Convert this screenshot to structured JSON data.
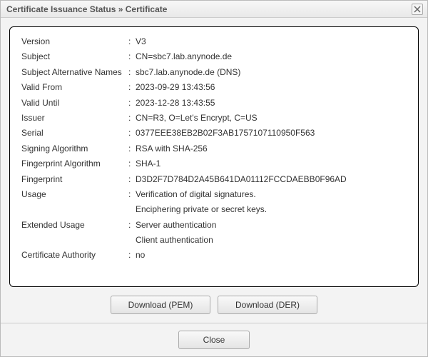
{
  "window": {
    "title": "Certificate Issuance Status » Certificate"
  },
  "fields": [
    {
      "label": "Version",
      "value": "V3"
    },
    {
      "label": "Subject",
      "value": "CN=sbc7.lab.anynode.de"
    },
    {
      "label": "Subject Alternative Names",
      "value": "sbc7.lab.anynode.de (DNS)"
    },
    {
      "label": "Valid From",
      "value": "2023-09-29 13:43:56"
    },
    {
      "label": "Valid Until",
      "value": "2023-12-28 13:43:55"
    },
    {
      "label": "Issuer",
      "value": "CN=R3, O=Let's Encrypt, C=US"
    },
    {
      "label": "Serial",
      "value": "0377EEE38EB2B02F3AB1757107110950F563"
    },
    {
      "label": "Signing Algorithm",
      "value": "RSA with SHA-256"
    },
    {
      "label": "Fingerprint Algorithm",
      "value": "SHA-1"
    },
    {
      "label": "Fingerprint",
      "value": "D3D2F7D784D2A45B641DA01112FCCDAEBB0F96AD"
    },
    {
      "label": "Usage",
      "value": "Verification of digital signatures.\nEnciphering private or secret keys."
    },
    {
      "label": "Extended Usage",
      "value": "Server authentication\nClient authentication"
    },
    {
      "label": "Certificate Authority",
      "value": "no"
    }
  ],
  "buttons": {
    "download_pem": "Download (PEM)",
    "download_der": "Download (DER)",
    "close": "Close"
  }
}
